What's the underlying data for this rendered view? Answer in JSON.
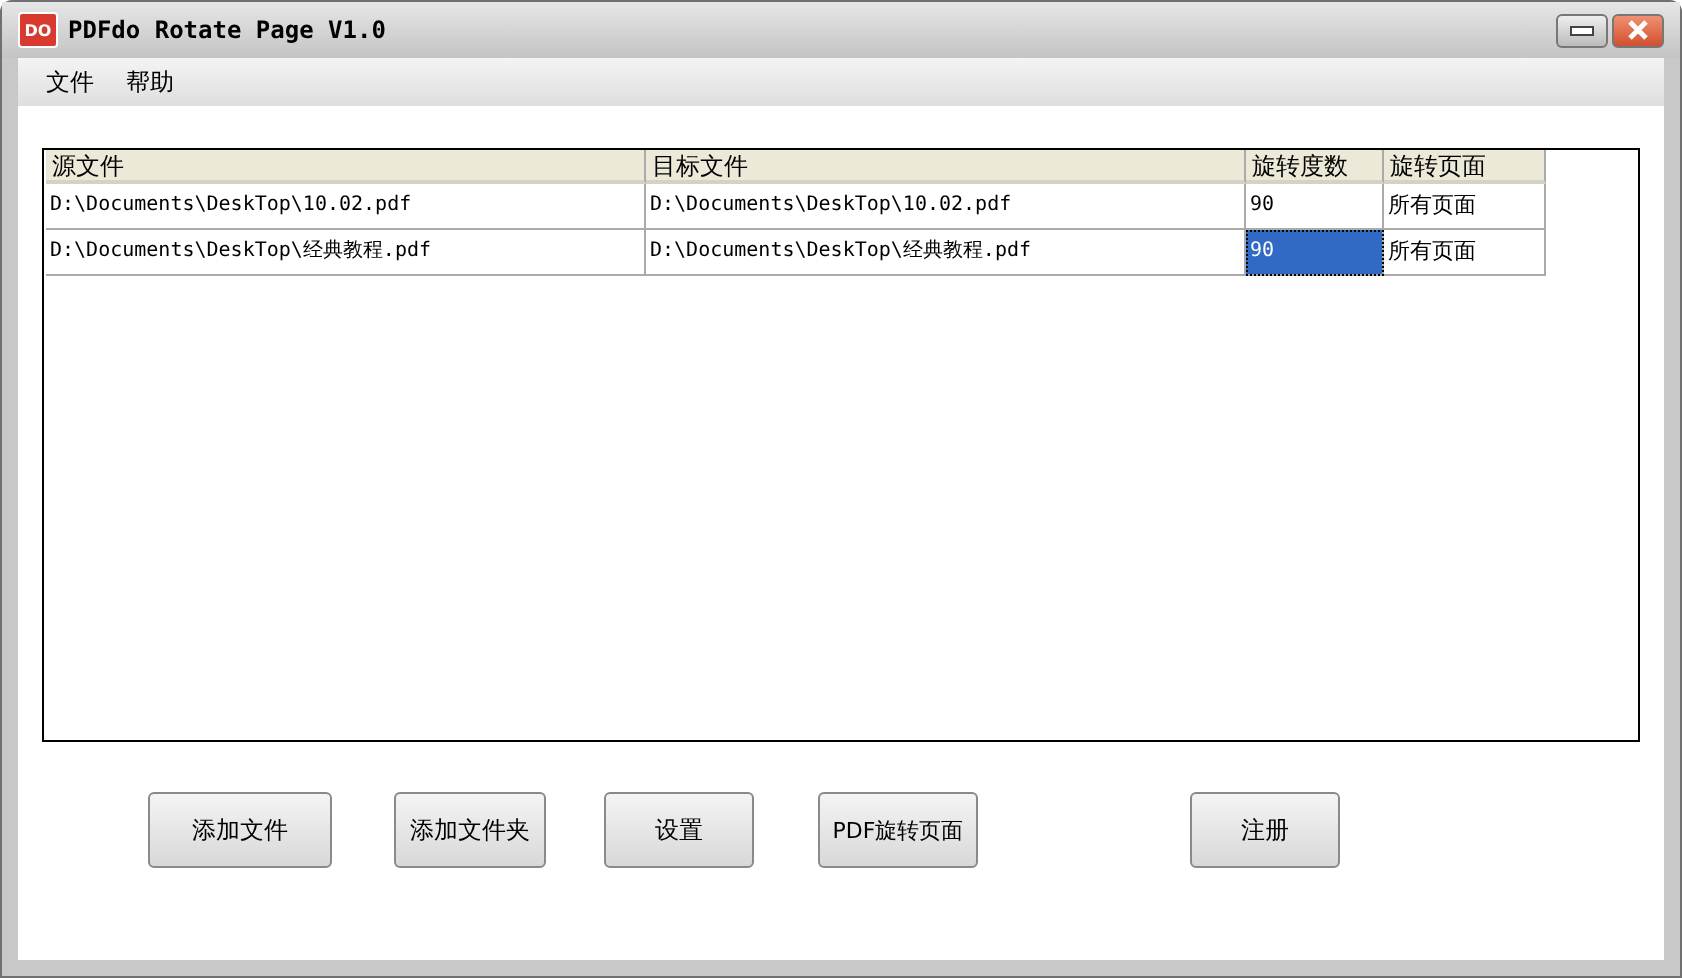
{
  "window": {
    "title": "PDFdo Rotate Page V1.0",
    "logo": "DO"
  },
  "menu": [
    "文件",
    "帮助"
  ],
  "table": {
    "columns": [
      "源文件",
      "目标文件",
      "旋转度数",
      "旋转页面"
    ],
    "rows": [
      {
        "cells": [
          {
            "text": "D:\\Documents\\DeskTop\\10.02.pdf",
            "selected": false
          },
          {
            "text": "D:\\Documents\\DeskTop\\10.02.pdf",
            "selected": false
          },
          {
            "text": "90",
            "selected": false
          },
          {
            "text": "所有页面",
            "selected": false
          }
        ]
      },
      {
        "cells": [
          {
            "text": "D:\\Documents\\DeskTop\\经典教程.pdf",
            "selected": false
          },
          {
            "text": "D:\\Documents\\DeskTop\\经典教程.pdf",
            "selected": false
          },
          {
            "text": "90",
            "selected": true
          },
          {
            "text": "所有页面",
            "selected": false
          }
        ]
      }
    ]
  },
  "buttons": [
    "添加文件",
    "添加文件夹",
    "设置",
    "PDF旋转页面",
    "注册"
  ]
}
